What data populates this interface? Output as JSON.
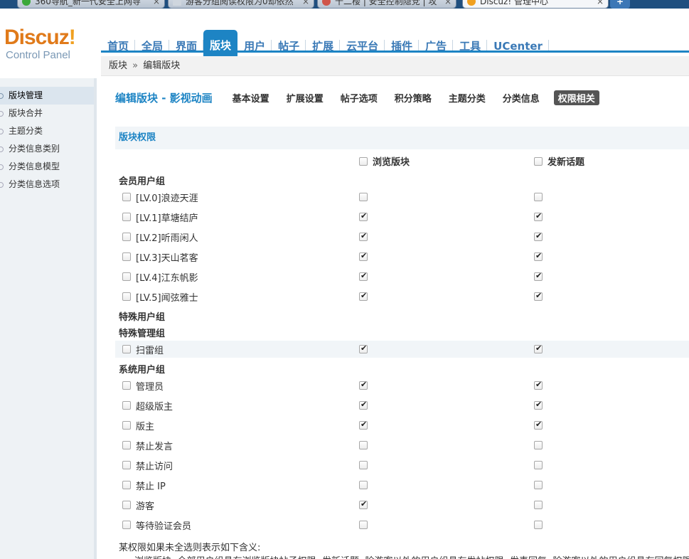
{
  "browser": {
    "tabs": [
      {
        "title": "360导航_新一代安全上网导",
        "icon_color": "#3aa83a"
      },
      {
        "title": "游客分组阅读权限为0却依然",
        "icon_color": "#cfd6de"
      },
      {
        "title": "十二楼 | 安全控制隐党 | 攻",
        "icon_color": "#d0554a"
      },
      {
        "title": "Discuz! 管理中心",
        "icon_color": "#f0a020"
      }
    ],
    "new_tab_label": "+"
  },
  "logo": {
    "brand": "Discuz",
    "bang": "!",
    "sub": "Control Panel"
  },
  "nav": {
    "items": [
      "首页",
      "全局",
      "界面",
      "版块",
      "用户",
      "帖子",
      "扩展",
      "云平台",
      "插件",
      "广告",
      "工具",
      "UCenter"
    ],
    "active_index": 3,
    "accent_color": "#1d84c4"
  },
  "breadcrumb": {
    "root": "版块",
    "separator": "»",
    "current": "编辑版块"
  },
  "sidebar": {
    "items": [
      {
        "label": "版块管理",
        "active": true
      },
      {
        "label": "版块合并",
        "active": false
      },
      {
        "label": "主题分类",
        "active": false
      },
      {
        "label": "分类信息类别",
        "active": false
      },
      {
        "label": "分类信息模型",
        "active": false
      },
      {
        "label": "分类信息选项",
        "active": false
      }
    ]
  },
  "page": {
    "title": "编辑版块 - 影视动画",
    "subtabs": [
      "基本设置",
      "扩展设置",
      "帖子选项",
      "积分策略",
      "主题分类",
      "分类信息",
      "权限相关"
    ],
    "active_subtab": 6
  },
  "permissions": {
    "section_title": "版块权限",
    "columns": [
      "浏览版块",
      "发新话题"
    ],
    "groups": [
      {
        "label": "会员用户组",
        "rows": [
          {
            "name": "[LV.0]浪迹天涯",
            "browse": false,
            "post": false
          },
          {
            "name": "[LV.1]草塘结庐",
            "browse": true,
            "post": true
          },
          {
            "name": "[LV.2]听雨闲人",
            "browse": true,
            "post": true
          },
          {
            "name": "[LV.3]天山茗客",
            "browse": true,
            "post": true
          },
          {
            "name": "[LV.4]江东帆影",
            "browse": true,
            "post": true
          },
          {
            "name": "[LV.5]闻弦雅士",
            "browse": true,
            "post": true
          }
        ]
      },
      {
        "label": "特殊用户组",
        "rows": []
      },
      {
        "label": "特殊管理组",
        "rows": [
          {
            "name": "扫雷组",
            "browse": true,
            "post": true
          }
        ]
      },
      {
        "label": "系统用户组",
        "rows": [
          {
            "name": "管理员",
            "browse": true,
            "post": true
          },
          {
            "name": "超级版主",
            "browse": true,
            "post": true
          },
          {
            "name": "版主",
            "browse": true,
            "post": true
          },
          {
            "name": "禁止发言",
            "browse": false,
            "post": false
          },
          {
            "name": "禁止访问",
            "browse": false,
            "post": false
          },
          {
            "name": "禁止 IP",
            "browse": false,
            "post": false
          },
          {
            "name": "游客",
            "browse": true,
            "post": false
          },
          {
            "name": "等待验证会员",
            "browse": false,
            "post": false
          }
        ]
      }
    ],
    "note": "某权限如果未全选则表示如下含义:",
    "note_detail": "浏览版块: 全部用户组具有浏览版块帖子权限; 发新话题: 除游客以外的用户组具有发帖权限; 发表回复: 除游客以外的用户组具有回复权限; 查看"
  }
}
